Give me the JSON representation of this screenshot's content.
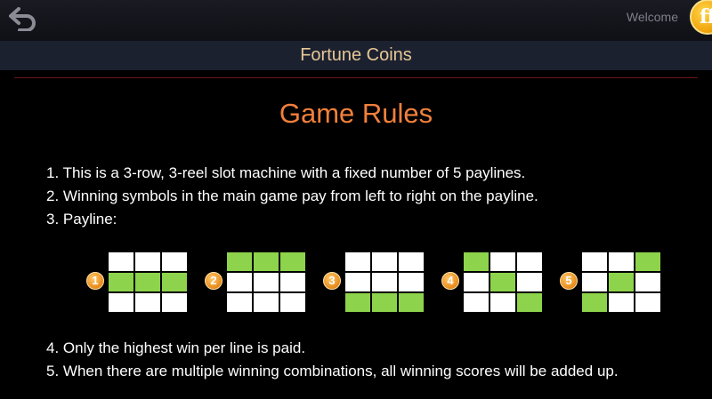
{
  "header": {
    "welcome": "Welcome",
    "coin_symbol": "ff"
  },
  "title": "Fortune Coins",
  "heading": "Game Rules",
  "rules_top": [
    "1. This is a 3-row, 3-reel slot machine with a fixed number of 5 paylines.",
    "2. Winning symbols in the main game pay from left to right on the payline.",
    "3. Payline:"
  ],
  "rules_bottom": [
    "4. Only the highest win per line is paid.",
    "5. When there are multiple winning combinations, all winning scores will be added up."
  ],
  "paylines": [
    {
      "number": "1",
      "cells": [
        [
          0,
          0,
          0
        ],
        [
          1,
          1,
          1
        ],
        [
          0,
          0,
          0
        ]
      ]
    },
    {
      "number": "2",
      "cells": [
        [
          1,
          1,
          1
        ],
        [
          0,
          0,
          0
        ],
        [
          0,
          0,
          0
        ]
      ]
    },
    {
      "number": "3",
      "cells": [
        [
          0,
          0,
          0
        ],
        [
          0,
          0,
          0
        ],
        [
          1,
          1,
          1
        ]
      ]
    },
    {
      "number": "4",
      "cells": [
        [
          1,
          0,
          0
        ],
        [
          0,
          1,
          0
        ],
        [
          0,
          0,
          1
        ]
      ]
    },
    {
      "number": "5",
      "cells": [
        [
          0,
          0,
          1
        ],
        [
          0,
          1,
          0
        ],
        [
          1,
          0,
          0
        ]
      ]
    }
  ],
  "colors": {
    "accent": "#f2803b",
    "title": "#e6c796",
    "payline_on": "#8dd34b"
  },
  "icons": {
    "back": "back-arrow-icon",
    "coin": "gold-coin-icon"
  }
}
